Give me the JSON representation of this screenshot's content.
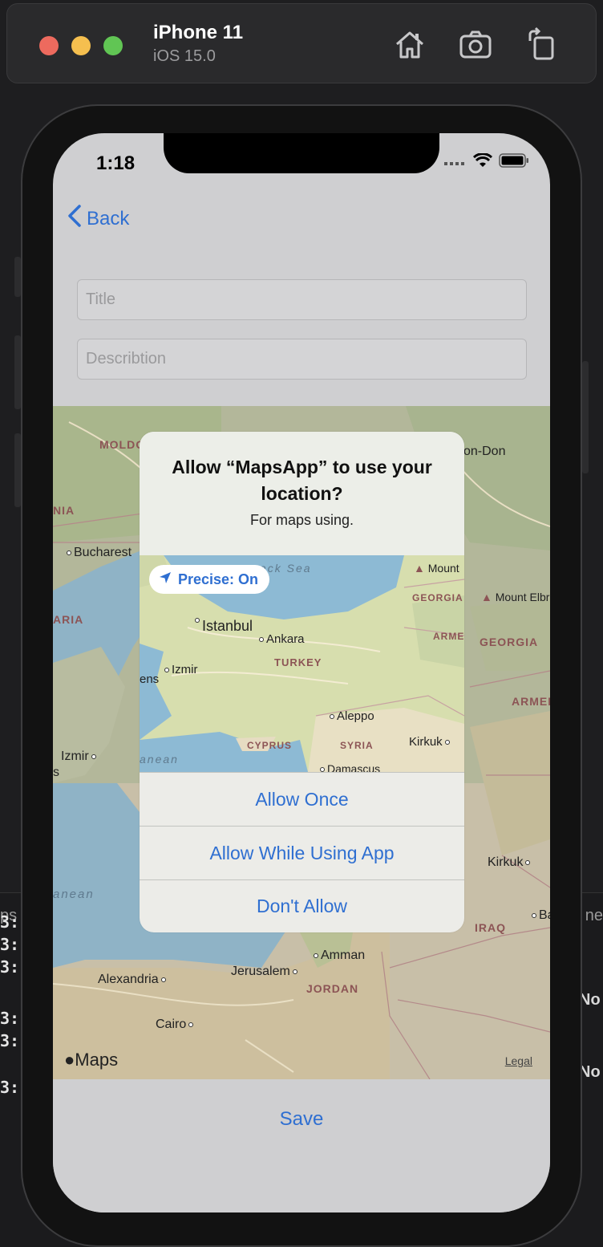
{
  "simulator": {
    "device_name": "iPhone 11",
    "os_version": "iOS 15.0",
    "toolbar_icons": [
      "home-icon",
      "screenshot-icon",
      "rotate-icon"
    ]
  },
  "background_console": {
    "left_header": "ps",
    "right_header": "ne",
    "left_lines": [
      "3:",
      "3:",
      "3:",
      "",
      "3:",
      "3:",
      "",
      "3:"
    ],
    "right_lines": [
      "No",
      "No"
    ]
  },
  "status_bar": {
    "time": "1:18"
  },
  "nav": {
    "back_label": "Back"
  },
  "form": {
    "title_placeholder": "Title",
    "description_placeholder": "Describtion"
  },
  "map": {
    "labels": {
      "moldova": "MOLDO",
      "romania": "NIA",
      "bucharest": "Bucharest",
      "bulgaria": "ARIA",
      "izmir": "Izmir",
      "s": "s",
      "anean": "anean",
      "rostov": "on-Don",
      "mount_elbr": "Mount Elbr",
      "georgia": "GEORGIA",
      "armen": "ARMEN",
      "kirkuk": "Kirkuk",
      "iraq": "IRAQ",
      "ba": "Ba",
      "amman": "Amman",
      "jerusalem": "Jerusalem",
      "jordan": "JORDAN",
      "alexandria": "Alexandria",
      "cairo": "Cairo"
    },
    "maps_brand": "Maps",
    "legal": "Legal"
  },
  "alert": {
    "title": "Allow “MapsApp” to use your location?",
    "message": "For maps using.",
    "precise_label": "Precise: On",
    "mini_map_labels": {
      "black_sea": "ack Sea",
      "mount": "Mount",
      "georgia": "GEORGIA",
      "armen": "ARMEI",
      "istanbul": "Istanbul",
      "ankara": "Ankara",
      "turkey": "TURKEY",
      "izmir": "Izmir",
      "ens": "ens",
      "aleppo": "Aleppo",
      "kirkuk": "Kirkuk",
      "cyprus": "CYPRUS",
      "syria": "SYRIA",
      "anean": "anean",
      "damascus": "Damascus"
    },
    "buttons": [
      "Allow Once",
      "Allow While Using App",
      "Don't Allow"
    ]
  },
  "footer": {
    "save_label": "Save"
  },
  "colors": {
    "accent": "#2f6fd1",
    "screen_dim": "#cfcfd1",
    "alert_bg": "#ecece8"
  }
}
